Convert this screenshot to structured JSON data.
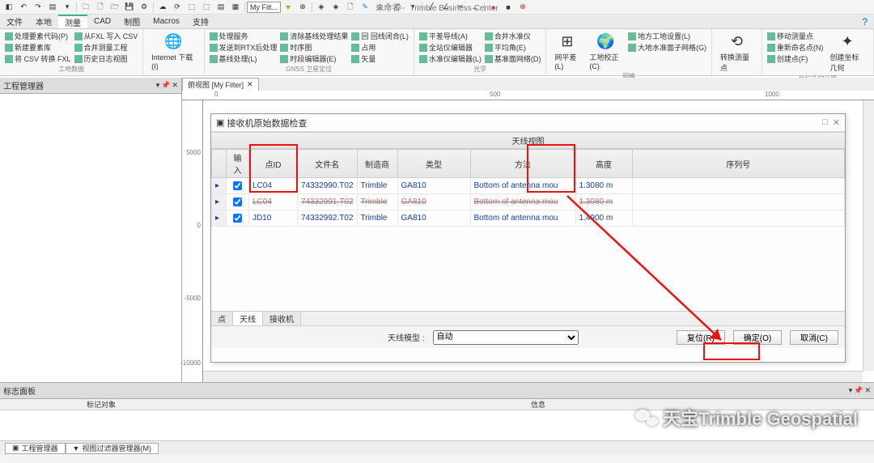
{
  "app": {
    "untitled": "未命名 -",
    "name": "Trimble Business Center",
    "my_filter": "My Filt..."
  },
  "menu": {
    "items": [
      "文件",
      "本地",
      "测量",
      "CAD",
      "制图",
      "Macros",
      "支持"
    ]
  },
  "ribbon": {
    "g1": {
      "title": "工地数据",
      "items": [
        "处理要素代码(P)",
        "从FXL 写入 CSV",
        "新建要素库",
        "合并测量工程",
        "将 CSV 转换 FXL",
        "历史日志视图"
      ]
    },
    "g2": {
      "label": "Internet 下载(I)"
    },
    "g3": {
      "title": "GNSS 卫星定位",
      "items": [
        "处理服务",
        "清除基线处理结果",
        "回 回线闭合(L)",
        "发送到RTX后处理",
        "时序图",
        "占用",
        "基线处理(L)",
        "时段编辑器(E)",
        "矢量"
      ]
    },
    "g4": {
      "title": "光学",
      "items": [
        "平差导线(A)",
        "合并水准仪",
        "全站仪编辑器",
        "平均角(E)",
        "水准仪编辑器(L)",
        "基准面网络(D)"
      ]
    },
    "g5": {
      "title": "网格",
      "items": [
        "网平差(L)",
        "工地校正(C)"
      ],
      "sub": [
        "地方工地设置(L)",
        "大地水准面子网格(G)"
      ]
    },
    "g6": {
      "label": "转换测量点"
    },
    "g7": {
      "title": "坐标几何计算",
      "items": [
        "移动测量点",
        "重新命名点(N)",
        "创建坐标几何",
        "创建点(F)"
      ]
    }
  },
  "side_panel": {
    "title": "工程管理器"
  },
  "view_tab": {
    "label": "俯视图 [My Filter]"
  },
  "ruler_h": [
    "0",
    "500",
    "1000"
  ],
  "ruler_v": [
    "5000",
    "0",
    "-5000",
    "-10000"
  ],
  "dialog": {
    "title": "接收机原始数据检查",
    "section": "天线视图",
    "headers": [
      "输入",
      "点ID",
      "文件名",
      "制造商",
      "类型",
      "方法",
      "高度",
      "序列号"
    ],
    "rows": [
      {
        "chk": true,
        "pid": "LC04",
        "file": "74332990.T02",
        "mfr": "Trimble",
        "type": "GA810",
        "method": "Bottom of antenna mou",
        "h": "1.3080 m"
      },
      {
        "chk": true,
        "pid": "LC04",
        "file": "74332991.T02",
        "mfr": "Trimble",
        "type": "GA810",
        "method": "Bottom of antenna mou",
        "h": "1.3080 m",
        "strike": true
      },
      {
        "chk": true,
        "pid": "JD10",
        "file": "74332992.T02",
        "mfr": "Trimble",
        "type": "GA810",
        "method": "Bottom of antenna mou",
        "h": "1.4900 m"
      }
    ],
    "tabs": [
      "点",
      "天线",
      "接收机"
    ],
    "model_label": "天线模型 :",
    "model_value": "自动",
    "btn_reset": "复位(R)",
    "btn_ok": "确定(O)",
    "btn_cancel": "取消(C)"
  },
  "flag_panel": {
    "title": "标志面板",
    "cols": [
      "标记对象",
      "信息"
    ]
  },
  "bottom": {
    "tab1": "工程管理器",
    "tab2": "视图过滤器管理器(M)"
  },
  "watermark": "天宝Trimble Geospatial"
}
